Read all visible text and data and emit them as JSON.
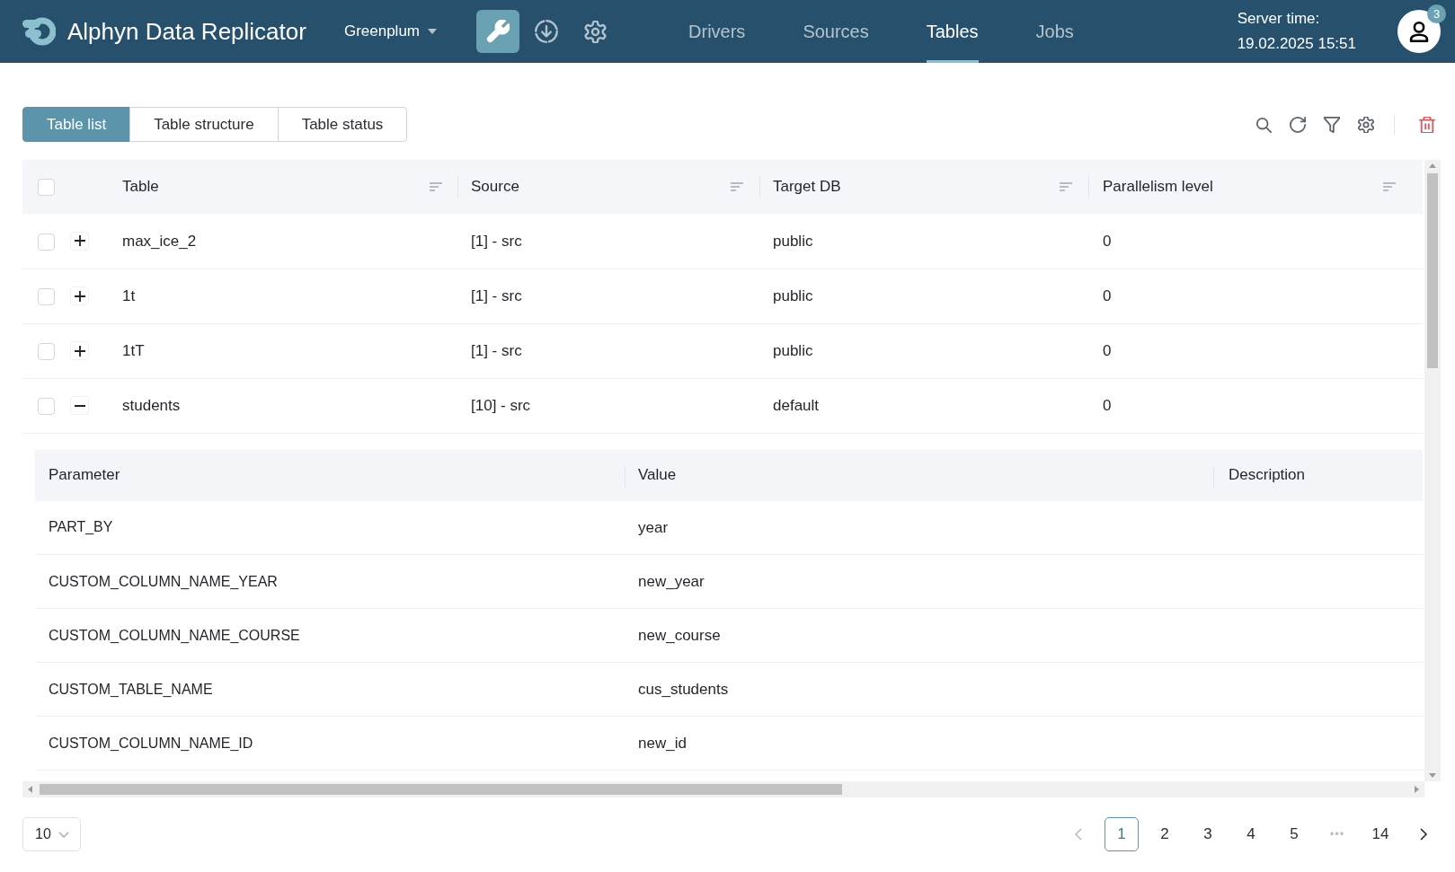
{
  "header": {
    "app_title": "Alphyn Data Replicator",
    "database": "Greenplum",
    "tools": [
      {
        "kind": "wrench",
        "selected": true
      },
      {
        "kind": "download",
        "selected": false
      },
      {
        "kind": "settings",
        "selected": false
      }
    ],
    "nav": [
      {
        "label": "Drivers",
        "selected": false
      },
      {
        "label": "Sources",
        "selected": false
      },
      {
        "label": "Tables",
        "selected": true
      },
      {
        "label": "Jobs",
        "selected": false
      }
    ],
    "server_time_label": "Server time:",
    "server_time": "19.02.2025 15:51",
    "notification_count": "3"
  },
  "view_tabs": [
    {
      "label": "Table list",
      "selected": true
    },
    {
      "label": "Table structure",
      "selected": false
    },
    {
      "label": "Table status",
      "selected": false
    }
  ],
  "table": {
    "all_checked": false,
    "columns": [
      "Table",
      "Source",
      "Target DB",
      "Parallelism level"
    ],
    "rows": [
      {
        "checked": false,
        "expanded": false,
        "table": "max_ice_2",
        "source": "[1] - src",
        "target_db": "public",
        "parallelism_level": "0"
      },
      {
        "checked": false,
        "expanded": false,
        "table": "1t",
        "source": "[1] - src",
        "target_db": "public",
        "parallelism_level": "0"
      },
      {
        "checked": false,
        "expanded": false,
        "table": "1tT",
        "source": "[1] - src",
        "target_db": "public",
        "parallelism_level": "0"
      },
      {
        "checked": false,
        "expanded": true,
        "table": "students",
        "source": "[10] - src",
        "target_db": "default",
        "parallelism_level": "0",
        "details": {
          "columns": [
            "Parameter",
            "Value",
            "Description"
          ],
          "rows": [
            {
              "parameter": "PART_BY",
              "value": "year"
            },
            {
              "parameter": "CUSTOM_COLUMN_NAME_YEAR",
              "value": "new_year"
            },
            {
              "parameter": "CUSTOM_COLUMN_NAME_COURSE",
              "value": "new_course"
            },
            {
              "parameter": "CUSTOM_TABLE_NAME",
              "value": "cus_students"
            },
            {
              "parameter": "CUSTOM_COLUMN_NAME_ID",
              "value": "new_id"
            }
          ]
        }
      }
    ]
  },
  "pagination": {
    "page_size": "10",
    "prev_disabled": true,
    "next_disabled": false,
    "pages": [
      {
        "kind": "page",
        "label": "1",
        "selected": true
      },
      {
        "kind": "page",
        "label": "2",
        "selected": false
      },
      {
        "kind": "page",
        "label": "3",
        "selected": false
      },
      {
        "kind": "page",
        "label": "4",
        "selected": false
      },
      {
        "kind": "page",
        "label": "5",
        "selected": false
      },
      {
        "kind": "ellipsis",
        "label": "•••",
        "selected": false
      },
      {
        "kind": "page",
        "label": "14",
        "selected": false
      }
    ]
  }
}
